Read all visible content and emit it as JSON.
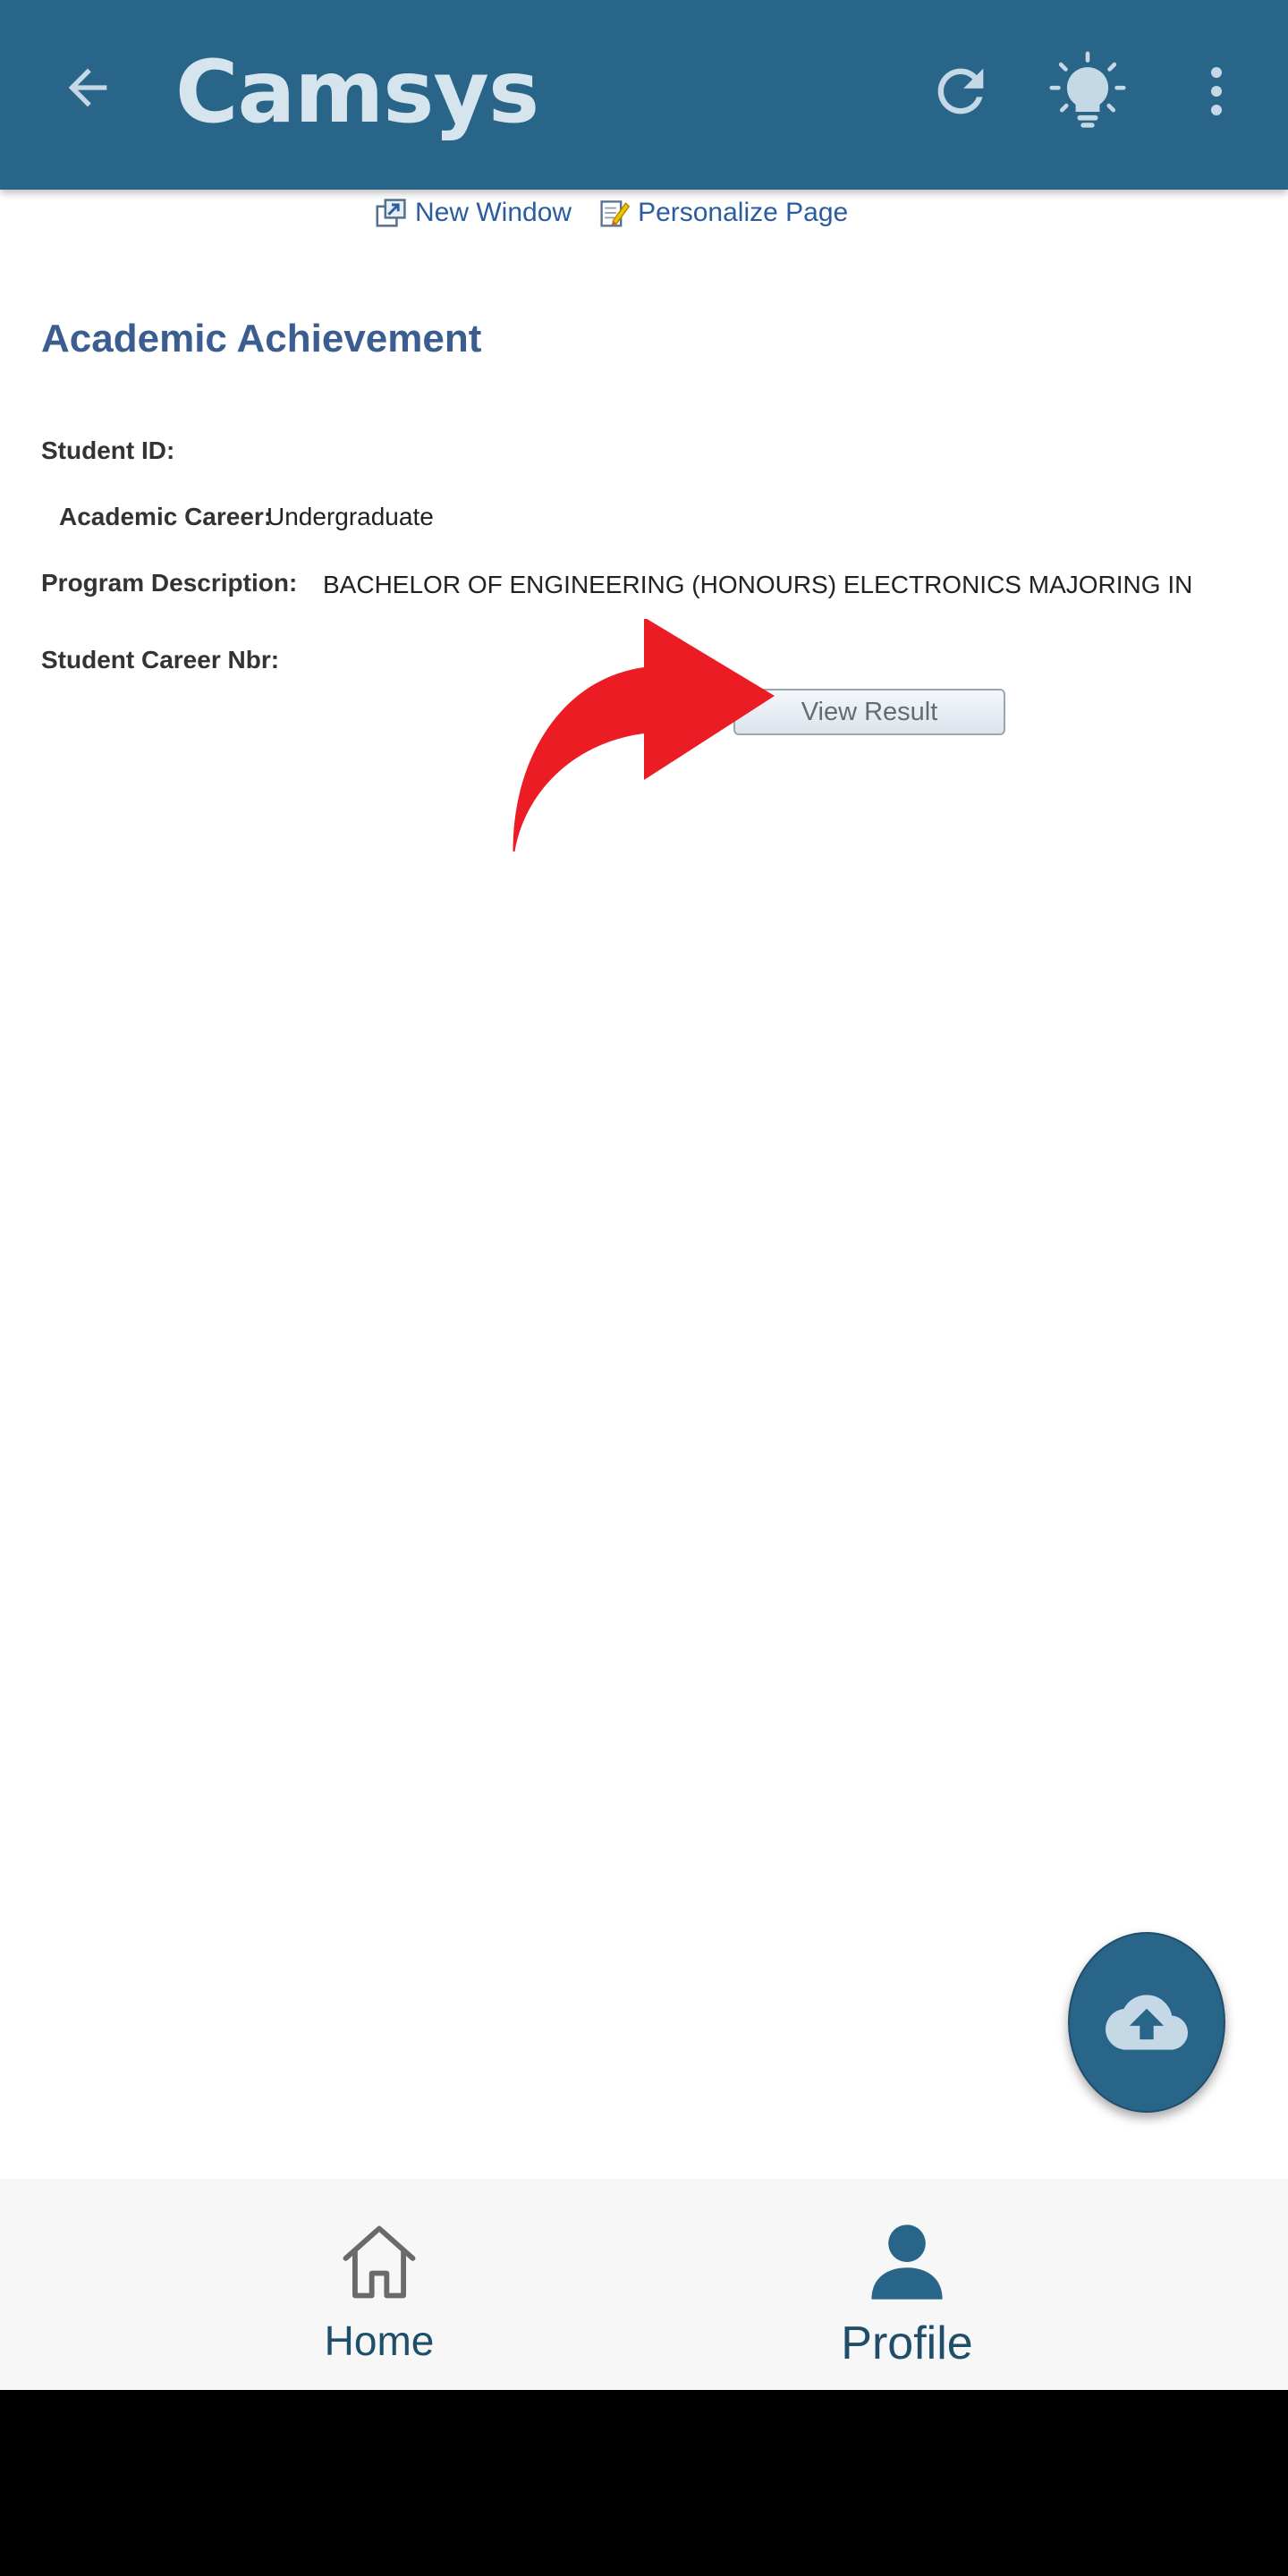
{
  "appbar": {
    "title": "Camsys",
    "back_icon": "arrow-left-icon",
    "refresh_icon": "refresh-icon",
    "tips_icon": "lightbulb-icon",
    "more_icon": "more-vertical-icon"
  },
  "links": {
    "new_window": "New Window",
    "personalize": "Personalize Page"
  },
  "page": {
    "heading": "Academic Achievement",
    "fields": {
      "student_id_label": "Student ID:",
      "academic_career_label": "Academic Career:",
      "academic_career_value": "Undergraduate",
      "program_description_label": "Program Description:",
      "program_description_value": "BACHELOR OF ENGINEERING (HONOURS) ELECTRONICS MAJORING IN",
      "student_career_nbr_label": "Student Career Nbr:"
    },
    "view_result_button": "View Result"
  },
  "fab": {
    "icon": "cloud-upload-icon"
  },
  "bottom_nav": {
    "items": [
      {
        "label": "Home",
        "icon": "home-icon"
      },
      {
        "label": "Profile",
        "icon": "person-icon"
      }
    ]
  },
  "colors": {
    "appbar": "#296589",
    "link": "#2a5d9f",
    "heading": "#3b5d8f",
    "annotation_arrow": "#ec1c24"
  }
}
